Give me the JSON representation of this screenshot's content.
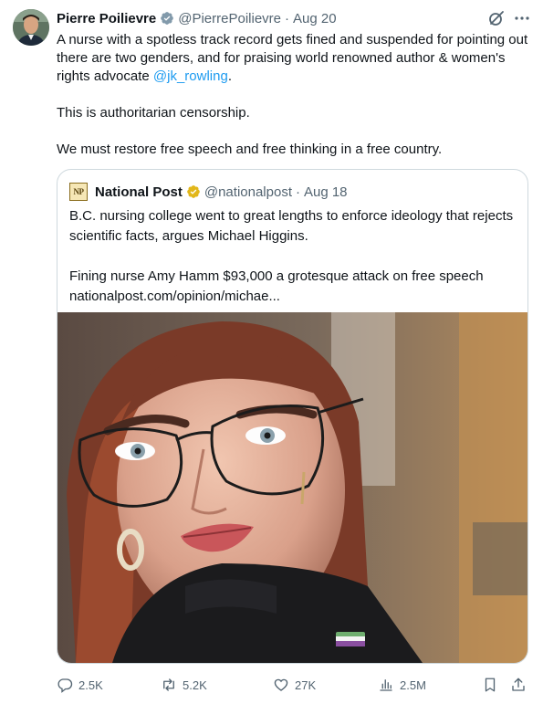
{
  "author": {
    "name": "Pierre Poilievre",
    "handle": "@PierrePoilievre",
    "separator": "·",
    "date": "Aug 20"
  },
  "tweet": {
    "line1_prefix": "A nurse with a spotless track record gets fined and suspended for pointing out there are two genders, and for praising world renowned author & women's rights advocate ",
    "mention": "@jk_rowling",
    "line1_suffix": ".",
    "line2": "This is authoritarian censorship.",
    "line3": "We must restore free speech and free thinking in a free country."
  },
  "quote": {
    "logo_text": "NP",
    "name": "National Post",
    "handle": "@nationalpost",
    "separator": "·",
    "date": "Aug 18",
    "text1": "B.C. nursing college went to great lengths to enforce ideology that rejects scientific facts, argues Michael Higgins.",
    "text2": "Fining nurse Amy Hamm $93,000 a grotesque attack on free speech",
    "link": "nationalpost.com/opinion/michae..."
  },
  "actions": {
    "replies": "2.5K",
    "reposts": "5.2K",
    "likes": "27K",
    "views": "2.5M"
  },
  "colors": {
    "text": "#0f1419",
    "muted": "#536471",
    "link": "#1d9bf0",
    "verified_gold": "#e2b719",
    "verified_gray": "#829aab",
    "border": "#cfd9de"
  },
  "icons": [
    "verified-gray-icon",
    "grok-icon",
    "more-icon",
    "verified-gold-icon",
    "reply-icon",
    "repost-icon",
    "like-icon",
    "views-icon",
    "bookmark-icon",
    "share-icon"
  ]
}
